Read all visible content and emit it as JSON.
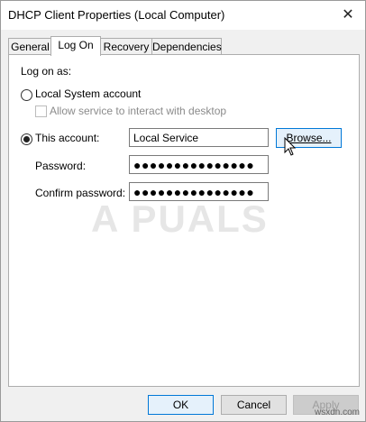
{
  "window": {
    "title": "DHCP Client Properties (Local Computer)",
    "close": "✕"
  },
  "tabs": [
    "General",
    "Log On",
    "Recovery",
    "Dependencies"
  ],
  "logon": {
    "heading": "Log on as:",
    "local_system": "Local System account",
    "allow_interact": "Allow service to interact with desktop",
    "this_account": "This account:",
    "account_value": "Local Service",
    "browse": "Browse...",
    "password_label": "Password:",
    "password_value": "●●●●●●●●●●●●●●●",
    "confirm_label": "Confirm password:",
    "confirm_value": "●●●●●●●●●●●●●●●"
  },
  "buttons": {
    "ok": "OK",
    "cancel": "Cancel",
    "apply": "Apply"
  },
  "watermark": "A PUALS",
  "site": "wsxdn.com"
}
